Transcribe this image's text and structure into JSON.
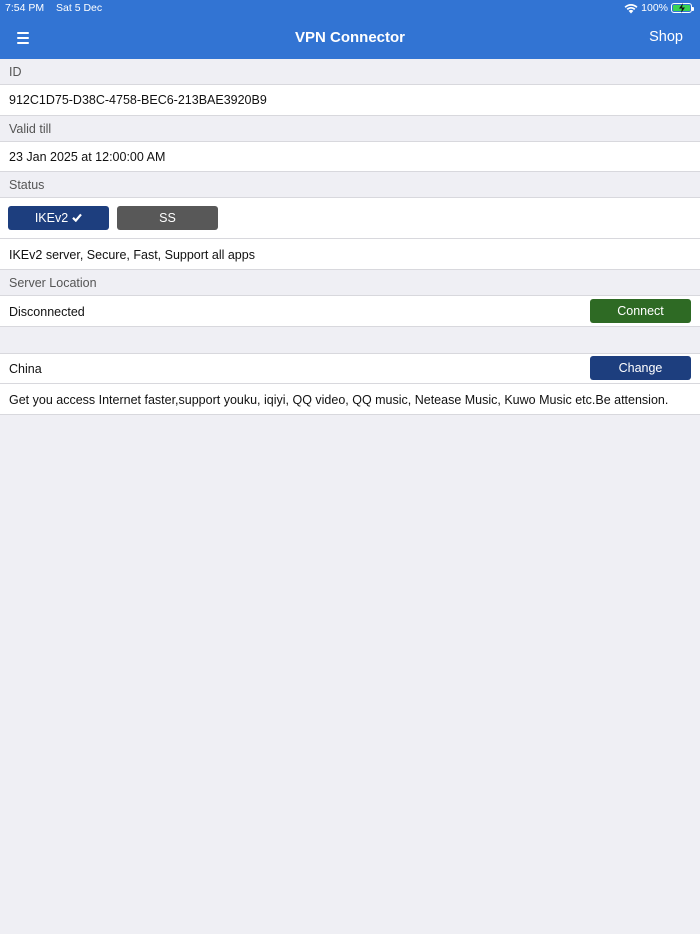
{
  "status_bar": {
    "time": "7:54 PM",
    "date": "Sat 5 Dec",
    "battery": "100%",
    "icons": [
      "wifi-icon",
      "battery-charging-icon"
    ]
  },
  "navbar": {
    "menu_icon": "hamburger-menu-icon",
    "title": "VPN Connector",
    "shop_label": "Shop"
  },
  "id_section": {
    "header": "ID",
    "value": "912C1D75-D38C-4758-BEC6-213BAE3920B9"
  },
  "valid_section": {
    "header": "Valid till",
    "value": "23 Jan 2025 at 12:00:00 AM"
  },
  "status_section": {
    "header": "Status",
    "protocols": [
      {
        "label": "IKEv2",
        "selected": true,
        "color": "#1d3e7e"
      },
      {
        "label": "SS",
        "selected": false,
        "color": "#585858"
      }
    ],
    "description": "IKEv2 server, Secure, Fast, Support all apps"
  },
  "server_section": {
    "header": "Server Location",
    "connection_status": "Disconnected",
    "connect_label": "Connect",
    "connect_color": "#2e6a24",
    "location": "China",
    "change_label": "Change",
    "change_color": "#1d3e7e",
    "location_description": "Get you access Internet faster,support youku, iqiyi, QQ video, QQ music, Netease Music, Kuwo Music etc.Be attension."
  },
  "colors": {
    "accent": "#3274d3",
    "background": "#efeff4"
  }
}
